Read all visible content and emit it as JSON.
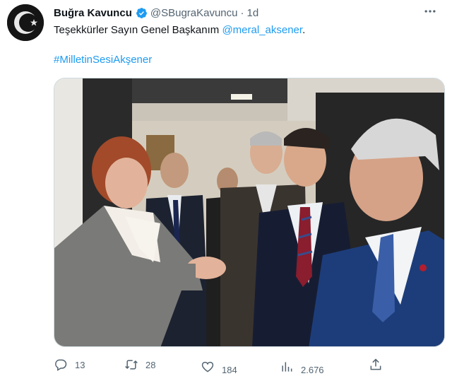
{
  "author": {
    "display_name": "Buğra Kavuncu",
    "handle": "@SBugraKavuncu",
    "separator": "·",
    "timestamp": "1d",
    "avatar_icon": "crescent-star-avatar",
    "verified_color": "#1d9bf0"
  },
  "tweet": {
    "text": "Teşekkürler Sayın Genel Başkanım ",
    "mention": "@meral_aksener",
    "text_end": ".",
    "hashtag": "#MilletinSesiAkşener"
  },
  "more_icon": "ellipsis-icon",
  "actions": {
    "reply_count": "13",
    "retweet_count": "28",
    "like_count": "184",
    "views_count": "2.676"
  },
  "colors": {
    "accent": "#1d9bf0",
    "secondary_text": "#536471",
    "primary_text": "#0f1419"
  }
}
